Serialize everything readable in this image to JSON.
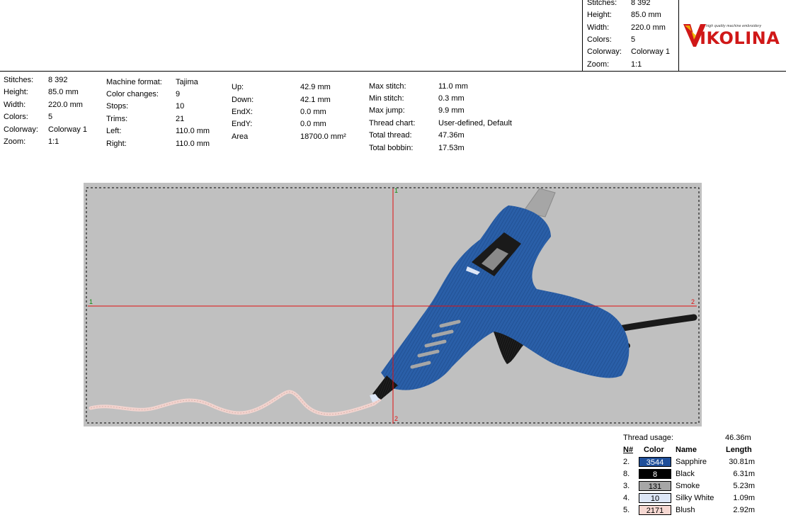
{
  "header_summary": [
    {
      "label": "Stitches:",
      "value": "8 392"
    },
    {
      "label": "Height:",
      "value": "85.0 mm"
    },
    {
      "label": "Width:",
      "value": "220.0 mm"
    },
    {
      "label": "Colors:",
      "value": "5"
    },
    {
      "label": "Colorway:",
      "value": "Colorway 1"
    },
    {
      "label": "Zoom:",
      "value": "1:1"
    }
  ],
  "logo": {
    "tagline": "high quality machine embroidery",
    "text": "VIKOLINA",
    "accent": "#d01818"
  },
  "info_col1": [
    {
      "label": "Stitches:",
      "value": "8 392"
    },
    {
      "label": "Height:",
      "value": "85.0 mm"
    },
    {
      "label": "Width:",
      "value": "220.0 mm"
    },
    {
      "label": "Colors:",
      "value": "5"
    },
    {
      "label": "Colorway:",
      "value": "Colorway 1"
    },
    {
      "label": "Zoom:",
      "value": "1:1"
    }
  ],
  "info_col2": [
    {
      "label": "Machine format:",
      "value": "Tajima"
    },
    {
      "label": "Color changes:",
      "value": "9"
    },
    {
      "label": "Stops:",
      "value": "10"
    },
    {
      "label": "Trims:",
      "value": "21"
    },
    {
      "label": "Left:",
      "value": "110.0 mm"
    },
    {
      "label": "Right:",
      "value": "110.0 mm"
    }
  ],
  "info_col3": [
    {
      "label": "Up:",
      "value": "42.9 mm"
    },
    {
      "label": "Down:",
      "value": "42.1 mm"
    },
    {
      "label": "EndX:",
      "value": "0.0 mm"
    },
    {
      "label": "EndY:",
      "value": "0.0 mm"
    },
    {
      "label": "Area",
      "value": "18700.0 mm²"
    }
  ],
  "info_col4": [
    {
      "label": "Max stitch:",
      "value": "11.0 mm"
    },
    {
      "label": "Min stitch:",
      "value": "0.3 mm"
    },
    {
      "label": "Max jump:",
      "value": "9.9 mm"
    },
    {
      "label": "Thread chart:",
      "value": "User-defined, Default"
    },
    {
      "label": "Total thread:",
      "value": "47.36m"
    },
    {
      "label": "Total bobbin:",
      "value": "17.53m"
    }
  ],
  "design": {
    "background": "#c0c0c0",
    "crosshair_color": "#e01010",
    "marker_top": "1",
    "marker_left": "1",
    "marker_right": "2",
    "marker_bottom": "2"
  },
  "thread_usage": {
    "title": "Thread usage:",
    "total": "46.36m",
    "headers": {
      "num": "N#",
      "color": "Color",
      "name": "Name",
      "length": "Length"
    },
    "rows": [
      {
        "num": "2.",
        "code": "3544",
        "name": "Sapphire",
        "length": "30.81m",
        "swatch": "#1f4f9a",
        "text_color": "#ffffff"
      },
      {
        "num": "8.",
        "code": "8",
        "name": "Black",
        "length": "6.31m",
        "swatch": "#000000",
        "text_color": "#ffffff"
      },
      {
        "num": "3.",
        "code": "131",
        "name": "Smoke",
        "length": "5.23m",
        "swatch": "#a6a6a6",
        "text_color": "#000000"
      },
      {
        "num": "4.",
        "code": "10",
        "name": "Silky White",
        "length": "1.09m",
        "swatch": "#dde6f6",
        "text_color": "#000000"
      },
      {
        "num": "5.",
        "code": "2171",
        "name": "Blush",
        "length": "2.92m",
        "swatch": "#f6d8d2",
        "text_color": "#000000"
      }
    ]
  }
}
